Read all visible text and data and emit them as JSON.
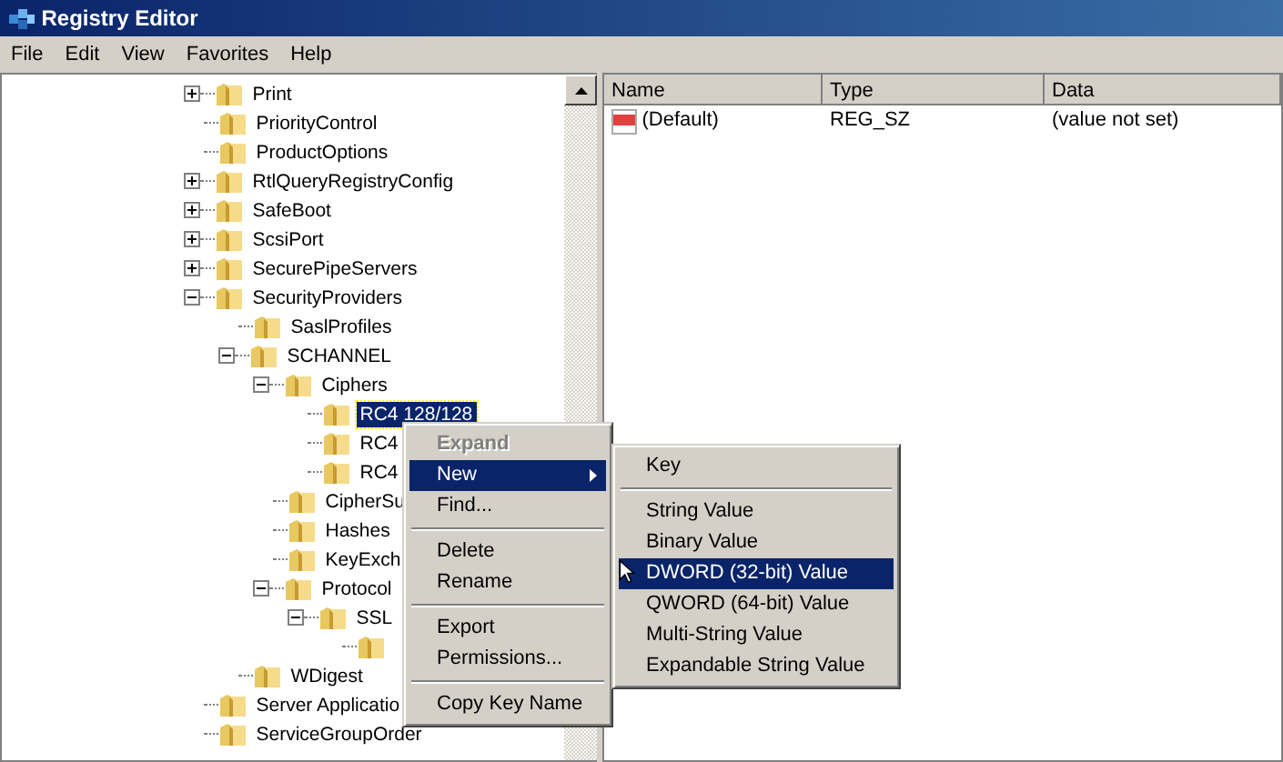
{
  "window": {
    "title": "Registry Editor"
  },
  "menu_bar": [
    "File",
    "Edit",
    "View",
    "Favorites",
    "Help"
  ],
  "tree": [
    {
      "label": "Print",
      "kind": "collapsed",
      "selected": false
    },
    {
      "label": "PriorityControl",
      "kind": "leaf",
      "selected": false
    },
    {
      "label": "ProductOptions",
      "kind": "leaf",
      "selected": false
    },
    {
      "label": "RtlQueryRegistryConfig",
      "kind": "collapsed",
      "selected": false
    },
    {
      "label": "SafeBoot",
      "kind": "collapsed",
      "selected": false
    },
    {
      "label": "ScsiPort",
      "kind": "collapsed",
      "selected": false
    },
    {
      "label": "SecurePipeServers",
      "kind": "collapsed",
      "selected": false
    },
    {
      "label": "SecurityProviders",
      "kind": "expanded",
      "selected": false,
      "children": [
        {
          "label": "SaslProfiles",
          "kind": "leaf",
          "selected": false
        },
        {
          "label": "SCHANNEL",
          "kind": "expanded",
          "selected": false,
          "children": [
            {
              "label": "Ciphers",
              "kind": "expanded",
              "selected": false,
              "children": [
                {
                  "label": "RC4 128/128",
                  "kind": "leaf",
                  "selected": true
                },
                {
                  "label": "RC4",
                  "kind": "leaf",
                  "selected": false
                },
                {
                  "label": "RC4",
                  "kind": "leaf",
                  "selected": false
                }
              ]
            },
            {
              "label": "CipherSu",
              "kind": "leaf",
              "selected": false
            },
            {
              "label": "Hashes",
              "kind": "leaf",
              "selected": false
            },
            {
              "label": "KeyExch",
              "kind": "leaf",
              "selected": false
            },
            {
              "label": "Protocol",
              "kind": "expanded",
              "selected": false,
              "children": [
                {
                  "label": "SSL",
                  "kind": "expanded",
                  "selected": false,
                  "children": [
                    {
                      "kind": "leaf",
                      "selected": false
                    }
                  ]
                }
              ]
            }
          ]
        },
        {
          "label": "WDigest",
          "kind": "leaf",
          "selected": false
        }
      ]
    },
    {
      "label": "Server Applicatio",
      "kind": "leaf",
      "selected": false
    },
    {
      "label": "ServiceGroupOrder",
      "kind": "leaf",
      "selected": false
    }
  ],
  "values": {
    "columns": [
      "Name",
      "Type",
      "Data"
    ],
    "rows": [
      {
        "name": "(Default)",
        "type": "REG_SZ",
        "data": "(value not set)"
      }
    ]
  },
  "context_menu": [
    {
      "kind": "item",
      "label": "Expand",
      "default": true,
      "disabled": true,
      "selected": false,
      "submenu": false
    },
    {
      "kind": "item",
      "label": "New",
      "default": false,
      "disabled": false,
      "selected": true,
      "submenu": true
    },
    {
      "kind": "item",
      "label": "Find...",
      "default": false,
      "disabled": false,
      "selected": false,
      "submenu": false
    },
    {
      "kind": "separator"
    },
    {
      "kind": "item",
      "label": "Delete",
      "default": false,
      "disabled": false,
      "selected": false,
      "submenu": false
    },
    {
      "kind": "item",
      "label": "Rename",
      "default": false,
      "disabled": false,
      "selected": false,
      "submenu": false
    },
    {
      "kind": "separator"
    },
    {
      "kind": "item",
      "label": "Export",
      "default": false,
      "disabled": false,
      "selected": false,
      "submenu": false
    },
    {
      "kind": "item",
      "label": "Permissions...",
      "default": false,
      "disabled": false,
      "selected": false,
      "submenu": false
    },
    {
      "kind": "separator"
    },
    {
      "kind": "item",
      "label": "Copy Key Name",
      "default": false,
      "disabled": false,
      "selected": false,
      "submenu": false
    }
  ],
  "submenu": [
    {
      "kind": "item",
      "label": "Key",
      "selected": false
    },
    {
      "kind": "separator"
    },
    {
      "kind": "item",
      "label": "String Value",
      "selected": false
    },
    {
      "kind": "item",
      "label": "Binary Value",
      "selected": false
    },
    {
      "kind": "item",
      "label": "DWORD (32-bit) Value",
      "selected": true
    },
    {
      "kind": "item",
      "label": "QWORD (64-bit) Value",
      "selected": false
    },
    {
      "kind": "item",
      "label": "Multi-String Value",
      "selected": false
    },
    {
      "kind": "item",
      "label": "Expandable String Value",
      "selected": false
    }
  ]
}
